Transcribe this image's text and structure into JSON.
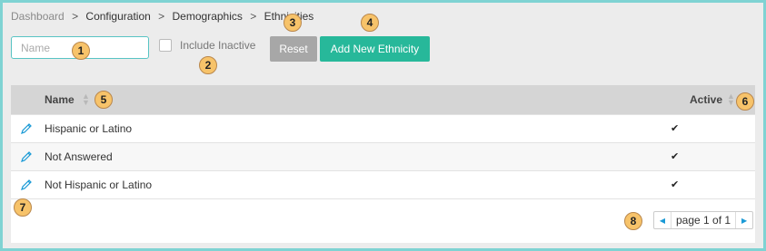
{
  "breadcrumb": [
    "Dashboard",
    "Configuration",
    "Demographics",
    "Ethnicities"
  ],
  "breadcrumb_sep": ">",
  "filters": {
    "name_placeholder": "Name",
    "include_inactive_label": "Include Inactive",
    "include_inactive_checked": false
  },
  "buttons": {
    "reset": "Reset",
    "add_new": "Add New Ethnicity"
  },
  "table": {
    "columns": {
      "name": "Name",
      "active": "Active"
    },
    "rows": [
      {
        "name": "Hispanic or Latino",
        "active": "✔"
      },
      {
        "name": "Not Answered",
        "active": "✔"
      },
      {
        "name": "Not Hispanic or Latino",
        "active": "✔"
      }
    ]
  },
  "pagination": {
    "text": "page 1 of 1"
  },
  "markers": [
    "1",
    "2",
    "3",
    "4",
    "5",
    "6",
    "7",
    "8"
  ],
  "colors": {
    "accent": "#27b89a",
    "input_border": "#58c4c4",
    "reset": "#a7a7a7",
    "marker": "#f7c36a",
    "frame": "#7fd3d3",
    "link": "#1a9ad6"
  },
  "icons": {
    "edit": "pencil-icon",
    "sort": "sort-icon",
    "active": "check-icon",
    "prev": "caret-left-icon",
    "next": "caret-right-icon"
  }
}
